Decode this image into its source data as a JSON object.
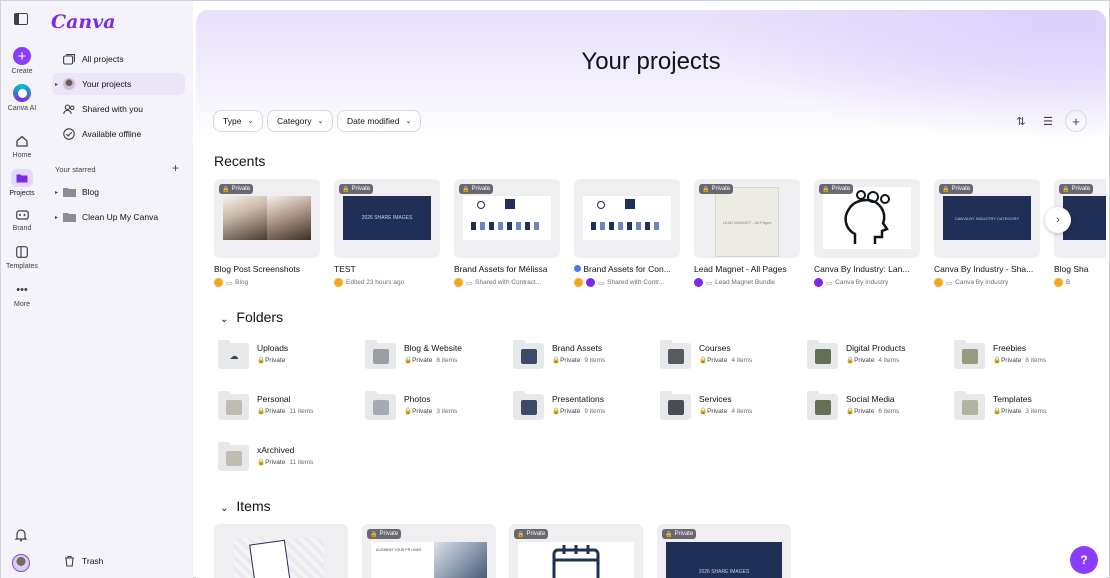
{
  "rail": {
    "create": "Create",
    "canva_ai": "Canva AI",
    "home": "Home",
    "projects": "Projects",
    "brand": "Brand",
    "templates": "Templates",
    "more": "More"
  },
  "sidebar": {
    "logo": "Canva",
    "nav": [
      {
        "label": "All projects",
        "icon": "folders-icon"
      },
      {
        "label": "Your projects",
        "icon": "avatar"
      },
      {
        "label": "Shared with you",
        "icon": "people-icon"
      },
      {
        "label": "Available offline",
        "icon": "offline-check-icon"
      }
    ],
    "starred_heading": "Your starred",
    "starred": [
      {
        "label": "Blog"
      },
      {
        "label": "Clean Up My Canva"
      }
    ],
    "trash": "Trash"
  },
  "page": {
    "title": "Your projects",
    "filters": [
      "Type",
      "Category",
      "Date modified"
    ]
  },
  "recents": {
    "heading": "Recents",
    "badge": "Private",
    "cards": [
      {
        "title": "Blog Post Screenshots",
        "meta": "Blog"
      },
      {
        "title": "TEST",
        "meta": "Edited 23 hours ago",
        "thumb_text": "2026 SHARE IMAGES"
      },
      {
        "title": "Brand Assets for Mélissa",
        "meta": "Shared with Contract..."
      },
      {
        "title": "Brand Assets for Con...",
        "meta": "Shared with Contr..."
      },
      {
        "title": "Lead Magnet - All Pages",
        "meta": "Lead Magnet Bundle",
        "thumb_text": "LEAD MAGNET - All Pages"
      },
      {
        "title": "Canva By Industry: Lan...",
        "meta": "Canva By Industry"
      },
      {
        "title": "Canva By Industry - Sha...",
        "meta": "Canva By Industry",
        "thumb_text": "CANVA BY INDUSTRY CATEGORY"
      },
      {
        "title": "Blog Sha",
        "meta": "B"
      }
    ]
  },
  "folders": {
    "heading": "Folders",
    "private": "Private",
    "items": [
      {
        "name": "Uploads",
        "count": ""
      },
      {
        "name": "Blog & Website",
        "count": "8 items"
      },
      {
        "name": "Brand Assets",
        "count": "9 items"
      },
      {
        "name": "Courses",
        "count": "4 items"
      },
      {
        "name": "Digital Products",
        "count": "4 items"
      },
      {
        "name": "Freebies",
        "count": "8 items"
      },
      {
        "name": "Personal",
        "count": "11 items"
      },
      {
        "name": "Photos",
        "count": "3 items"
      },
      {
        "name": "Presentations",
        "count": "9 items"
      },
      {
        "name": "Services",
        "count": "4 items"
      },
      {
        "name": "Social Media",
        "count": "6 items"
      },
      {
        "name": "Templates",
        "count": "3 items"
      },
      {
        "name": "xArchived",
        "count": "11 items"
      }
    ]
  },
  "items": {
    "heading": "Items",
    "badge": "Private",
    "thumb_texts": [
      "",
      "AUGMENT YOUR PR LINKS",
      "",
      "2026 SHARE IMAGES"
    ]
  },
  "help": "?",
  "colors": {
    "accent": "#7d2ae8",
    "navy": "#1f2f55",
    "help": "#8b3dff"
  }
}
